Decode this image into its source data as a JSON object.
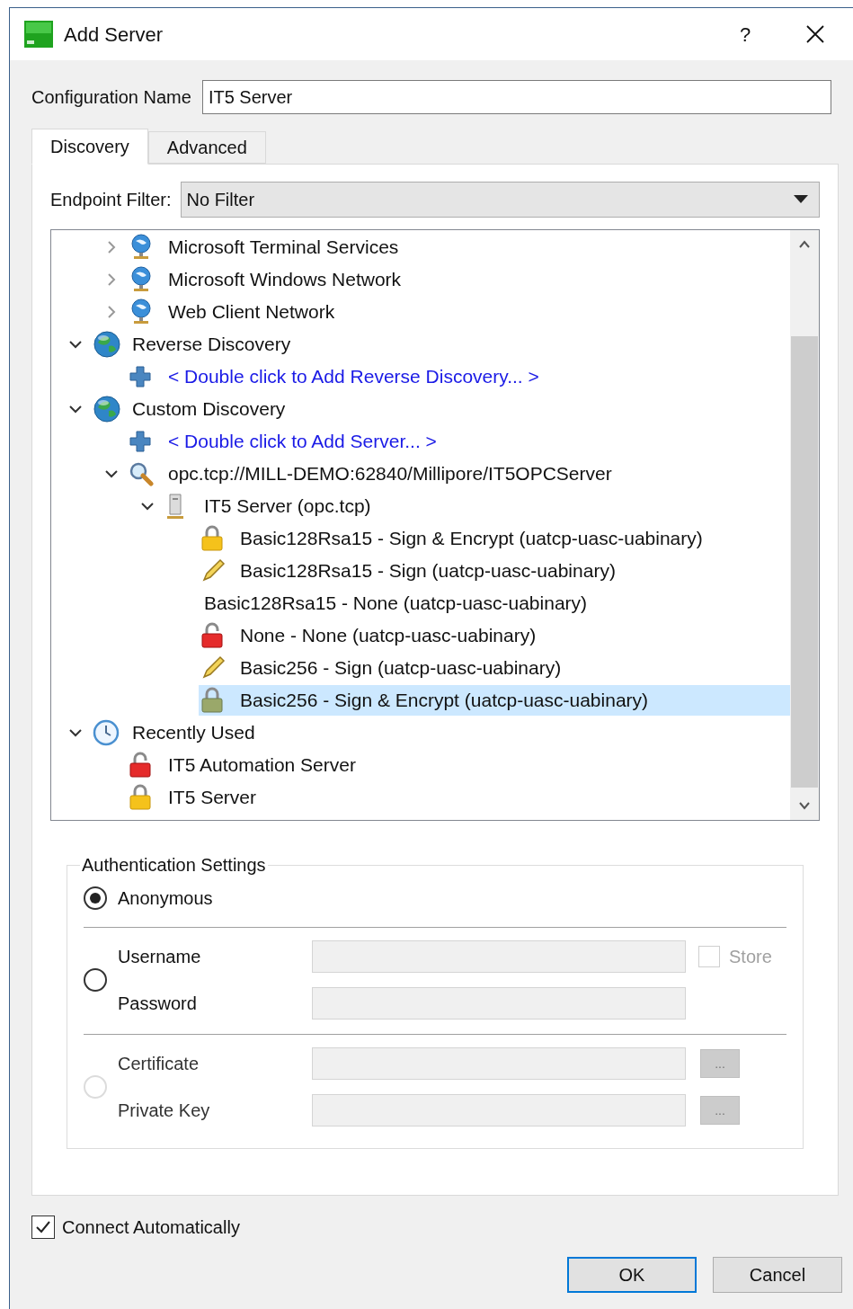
{
  "window": {
    "title": "Add Server",
    "help": "?"
  },
  "config_name": {
    "label": "Configuration Name",
    "value": "IT5 Server"
  },
  "tabs": [
    {
      "label": "Discovery",
      "selected": true
    },
    {
      "label": "Advanced",
      "selected": false
    }
  ],
  "endpoint_filter": {
    "label": "Endpoint Filter:",
    "value": "No Filter"
  },
  "tree": {
    "items": [
      {
        "children": [
          {
            "label": "Microsoft Terminal Services",
            "kind": "network",
            "expanded": false
          },
          {
            "label": "Microsoft Windows Network",
            "kind": "network",
            "expanded": false
          },
          {
            "label": "Web Client Network",
            "kind": "network",
            "expanded": false
          }
        ]
      },
      {
        "label": "Reverse Discovery",
        "kind": "globe",
        "expanded": true,
        "children": [
          {
            "label": "< Double click to Add Reverse Discovery... >",
            "kind": "add-link"
          }
        ]
      },
      {
        "label": "Custom Discovery",
        "kind": "globe",
        "expanded": true,
        "children": [
          {
            "label": "< Double click to Add Server... >",
            "kind": "add-link"
          },
          {
            "label": "opc.tcp://MILL-DEMO:62840/Millipore/IT5OPCServer",
            "kind": "search",
            "expanded": true,
            "children": [
              {
                "label": "IT5 Server (opc.tcp)",
                "kind": "server",
                "expanded": true,
                "children": [
                  {
                    "label": "Basic128Rsa15 - Sign & Encrypt (uatcp-uasc-uabinary)",
                    "kind": "lock",
                    "selected": false
                  },
                  {
                    "label": "Basic128Rsa15 - Sign (uatcp-uasc-uabinary)",
                    "kind": "pencil",
                    "selected": false
                  },
                  {
                    "label": "Basic128Rsa15 - None (uatcp-uasc-uabinary)",
                    "kind": "plain",
                    "selected": false
                  },
                  {
                    "label": "None - None (uatcp-uasc-uabinary)",
                    "kind": "lock-open",
                    "selected": false
                  },
                  {
                    "label": "Basic256 - Sign (uatcp-uasc-uabinary)",
                    "kind": "pencil",
                    "selected": false
                  },
                  {
                    "label": "Basic256 - Sign & Encrypt (uatcp-uasc-uabinary)",
                    "kind": "lock",
                    "selected": true
                  }
                ]
              }
            ]
          }
        ]
      },
      {
        "label": "Recently Used",
        "kind": "clock",
        "expanded": true,
        "children": [
          {
            "label": "IT5 Automation Server",
            "kind": "lock-open"
          },
          {
            "label": "IT5 Server",
            "kind": "lock"
          }
        ]
      }
    ]
  },
  "auth": {
    "title": "Authentication Settings",
    "options": [
      {
        "selected": true,
        "disabled": false,
        "fields": [
          {
            "kind": "label",
            "label": "Anonymous"
          }
        ]
      },
      {
        "selected": false,
        "disabled": false,
        "fields": [
          {
            "kind": "input",
            "label": "Username",
            "disabled": true,
            "store": {
              "label": "Store",
              "checked": false,
              "disabled": true
            }
          },
          {
            "kind": "input",
            "label": "Password",
            "disabled": true
          }
        ]
      },
      {
        "selected": false,
        "disabled": true,
        "fields": [
          {
            "kind": "input",
            "label": "Certificate",
            "disabled": true,
            "browse": "..."
          },
          {
            "kind": "input",
            "label": "Private Key",
            "disabled": true,
            "browse": "..."
          }
        ]
      }
    ]
  },
  "connect_automatically": {
    "label": "Connect Automatically",
    "checked": true
  },
  "buttons": [
    {
      "label": "OK",
      "default": true
    },
    {
      "label": "Cancel",
      "default": false
    }
  ]
}
